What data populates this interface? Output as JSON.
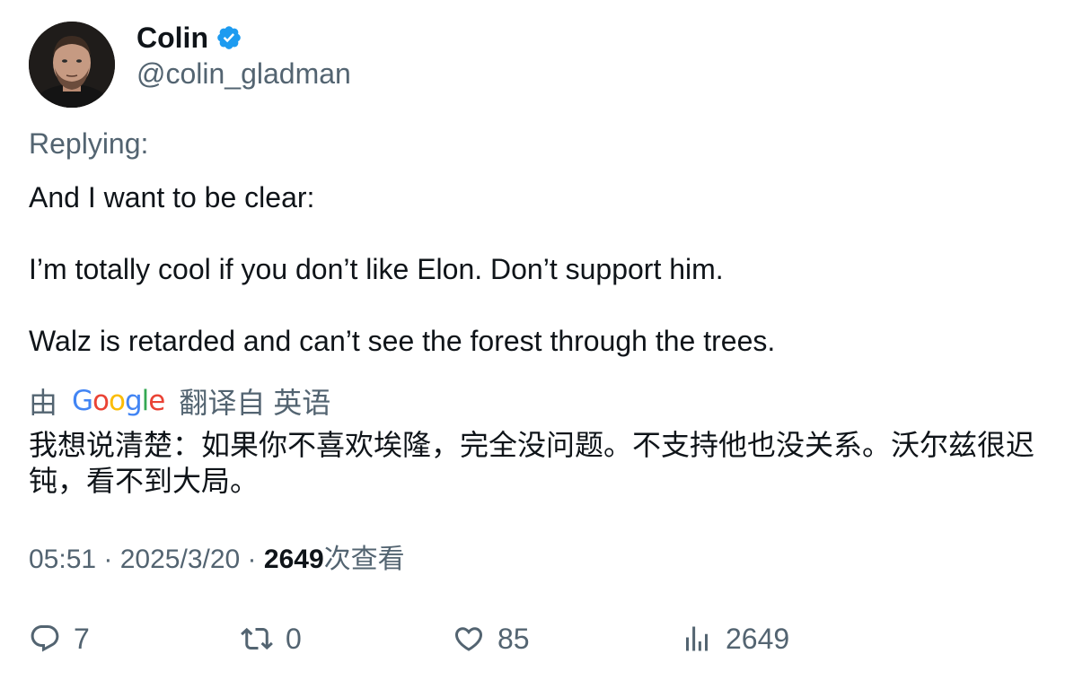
{
  "author": {
    "display_name": "Colin",
    "handle": "@colin_gladman",
    "verified_color": "#1d9bf0"
  },
  "replying_label": "Replying:",
  "tweet": {
    "paragraphs": [
      "And I want to be clear:",
      "I’m totally cool if you don’t like Elon. Don’t support him.",
      "Walz is retarded and can’t see the forest through the trees."
    ]
  },
  "translation": {
    "by_label": "由",
    "provider_letters": [
      "G",
      "o",
      "o",
      "g",
      "l",
      "e"
    ],
    "from_label": "翻译自 英语",
    "text": "我想说清楚：如果你不喜欢埃隆，完全没问题。不支持他也没关系。沃尔兹很迟钝，看不到大局。"
  },
  "meta": {
    "time": "05:51",
    "separator": " · ",
    "date": "2025/3/20",
    "views_count": "2649",
    "views_label": "次查看"
  },
  "actions": {
    "replies": "7",
    "retweets": "0",
    "likes": "85",
    "views": "2649"
  },
  "colors": {
    "text_primary": "#0f1419",
    "text_secondary": "#536471",
    "google_blue": "#4285F4",
    "google_red": "#EA4335",
    "google_yellow": "#FBBC05",
    "google_green": "#34A853"
  }
}
